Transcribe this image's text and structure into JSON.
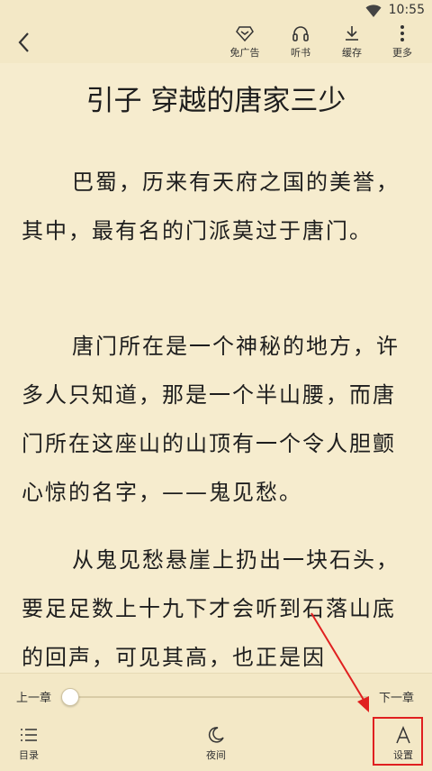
{
  "status": {
    "time": "10:55"
  },
  "toolbar": {
    "buttons": [
      {
        "label": "免广告",
        "icon": "diamond-icon"
      },
      {
        "label": "听书",
        "icon": "headphones-icon"
      },
      {
        "label": "缓存",
        "icon": "download-icon"
      },
      {
        "label": "更多",
        "icon": "more-vertical-icon"
      }
    ]
  },
  "content": {
    "title": "引子 穿越的唐家三少",
    "paragraphs": [
      "巴蜀，历来有天府之国的美誉，其中，最有名的门派莫过于唐门。",
      "唐门所在是一个神秘的地方，许多人只知道，那是一个半山腰，而唐门所在这座山的山顶有一个令人胆颤心惊的名字，——鬼见愁。",
      "从鬼见愁悬崖上扔出一块石头，要足足数上十九下才会听到石落山底的回声，可见其高，也正是因"
    ]
  },
  "progress": {
    "prev_label": "上一章",
    "next_label": "下一章",
    "value": 0
  },
  "bottom_bar": {
    "catalog_label": "目录",
    "night_label": "夜间",
    "settings_label": "设置"
  },
  "colors": {
    "background": "#f6ecce",
    "highlight": "#e02020"
  }
}
